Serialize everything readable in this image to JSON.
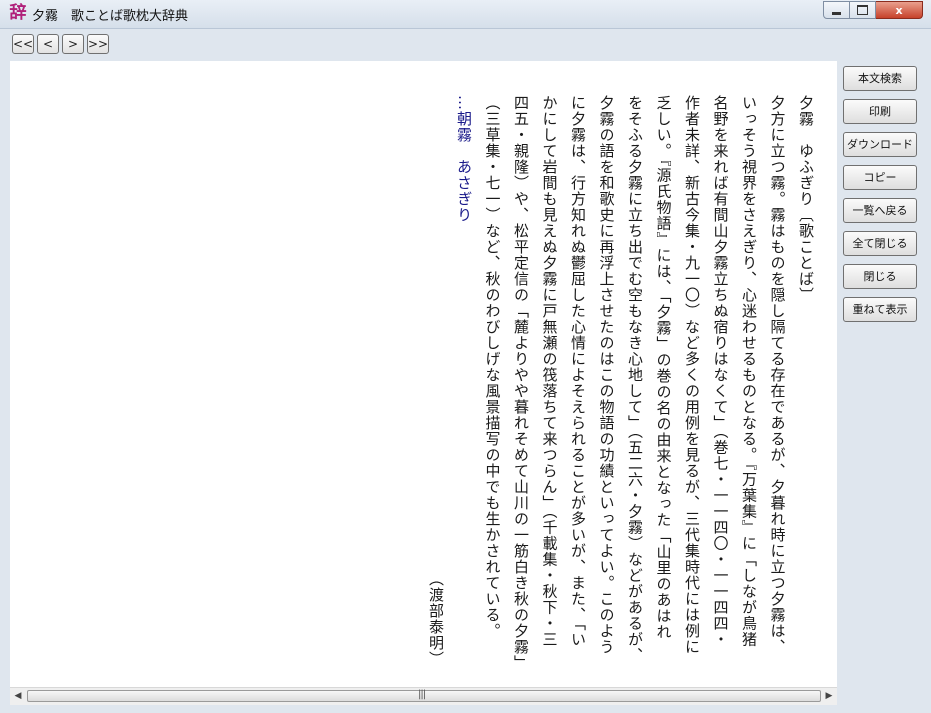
{
  "window": {
    "icon_char": "辞",
    "title": "夕霧　歌ことば歌枕大辞典",
    "close_char": "x"
  },
  "nav": {
    "first": "<<",
    "prev": "<",
    "next": ">",
    "last": ">>"
  },
  "entry": {
    "columns": [
      "夕霧　ゆふぎり〔歌ことば〕",
      "夕方に立つ霧。霧はものを隠し隔てる存在であるが、夕暮れ時に立つ夕霧は、",
      "いっそう視界をさえぎり、心迷わせるものとなる。『万葉集』に「しなが鳥猪",
      "名野を来れば有間山夕霧立ちぬ宿りはなくて」（巻七・一一四〇・一一四四・",
      "作者未詳、新古今集・九一〇）など多くの用例を見るが、三代集時代には例に",
      "乏しい。『源氏物語』には、「夕霧」の巻の名の由来となった「山里のあはれ",
      "をそふる夕霧に立ち出でむ空もなき心地して」（五二六・夕霧）などがあるが、",
      "夕霧の語を和歌史に再浮上させたのはこの物語の功績といってよい。このよう",
      "に夕霧は、行方知れぬ鬱屈した心情によそえられることが多いが、また、「い",
      "かにして岩間も見えぬ夕霧に戸無瀬の筏落ちて来つらん」（千載集・秋下・三",
      "四五・親隆）や、松平定信の「麓よりやや暮れそめて山川の一筋白き秋の夕霧」",
      "（三草集・七一）など、秋のわびしげな風景描写の中でも生かされている。",
      "…朝霧　あさぎり"
    ],
    "author": "（渡部泰明）"
  },
  "sidebar": {
    "buttons": [
      "本文検索",
      "印刷",
      "ダウンロード",
      "コピー",
      "一覧へ戻る",
      "全て閉じる",
      "閉じる",
      "重ねて表示"
    ]
  },
  "scrollbar": {
    "left_arrow": "◀",
    "right_arrow": "▶",
    "grip": "|||"
  }
}
